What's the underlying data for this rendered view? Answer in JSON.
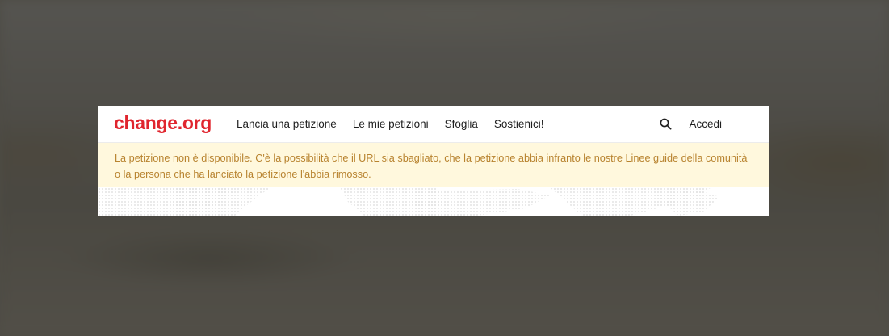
{
  "header": {
    "logo": "change.org",
    "nav": [
      "Lancia una petizione",
      "Le mie petizioni",
      "Sfoglia",
      "Sostienici!"
    ],
    "search_icon": "search-icon",
    "login": "Accedi"
  },
  "alert": {
    "message": "La petizione non è disponibile. C'è la possibilità che il URL sia sbagliato, che la petizione abbia infranto le nostre Linee guide della comunità o la persona che ha lanciato la petizione l'abbia rimosso."
  },
  "colors": {
    "brand": "#e0252e",
    "alert_bg": "#fff8dd",
    "alert_text": "#b8832f"
  }
}
